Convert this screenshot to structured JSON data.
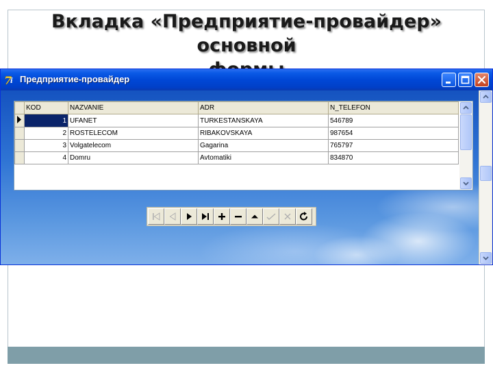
{
  "slide": {
    "title_line1": "Вкладка «Предприятие-провайдер» основной",
    "title_line2": "формы"
  },
  "window": {
    "title": "Предприятие-провайдер",
    "icon": "delphi-app-icon",
    "controls": [
      "minimize-icon",
      "maximize-icon",
      "close-icon"
    ]
  },
  "grid": {
    "columns": [
      "KOD",
      "NAZVANIE",
      "ADR",
      "N_TELEFON"
    ],
    "rows": [
      {
        "kod": "1",
        "nazvanie": "UFANET",
        "adr": "TURKESTANSKAYA",
        "n_telefon": "546789"
      },
      {
        "kod": "2",
        "nazvanie": "ROSTELECOM",
        "adr": "RIBAKOVSKAYA",
        "n_telefon": "987654"
      },
      {
        "kod": "3",
        "nazvanie": "Volgatelecom",
        "adr": "Gagarina",
        "n_telefon": "765797"
      },
      {
        "kod": "4",
        "nazvanie": "Domru",
        "adr": "Avtomatiki",
        "n_telefon": "834870"
      }
    ],
    "selected_row_index": 0
  },
  "navigator": {
    "buttons": [
      {
        "icon": "first-record-icon",
        "enabled": false
      },
      {
        "icon": "prior-record-icon",
        "enabled": false
      },
      {
        "icon": "next-record-icon",
        "enabled": true
      },
      {
        "icon": "last-record-icon",
        "enabled": true
      },
      {
        "icon": "insert-record-icon",
        "enabled": true
      },
      {
        "icon": "delete-record-icon",
        "enabled": true
      },
      {
        "icon": "edit-record-icon",
        "enabled": true
      },
      {
        "icon": "post-edit-icon",
        "enabled": false
      },
      {
        "icon": "cancel-edit-icon",
        "enabled": false
      },
      {
        "icon": "refresh-data-icon",
        "enabled": true
      }
    ]
  },
  "colors": {
    "titlebar": "#0047d6",
    "selection": "#0a246a",
    "footer_bar": "#7f9ea8"
  }
}
